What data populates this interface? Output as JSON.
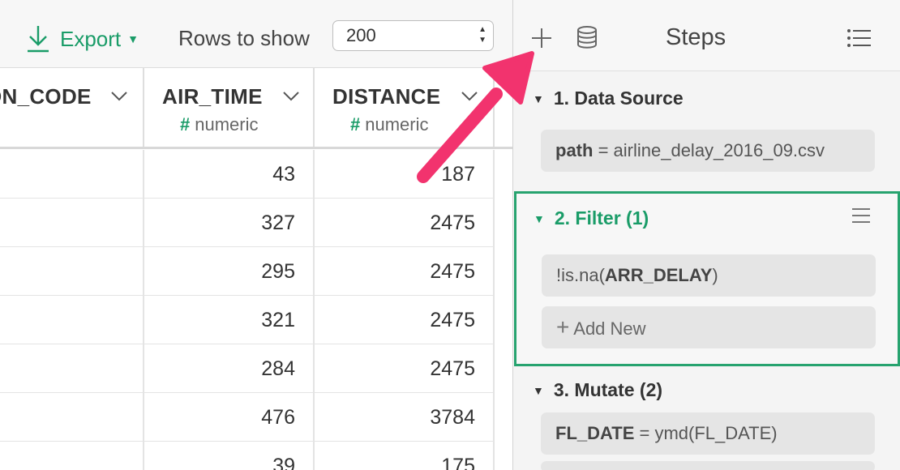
{
  "toolbar": {
    "export_label": "Export",
    "rows_label": "Rows to show",
    "rows_value": "200"
  },
  "table": {
    "columns": [
      {
        "name": "ON_CODE",
        "type": ""
      },
      {
        "name": "AIR_TIME",
        "type": "numeric"
      },
      {
        "name": "DISTANCE",
        "type": "numeric"
      }
    ],
    "type_symbol": "#",
    "rows": [
      [
        "",
        "43",
        "187"
      ],
      [
        "",
        "327",
        "2475"
      ],
      [
        "",
        "295",
        "2475"
      ],
      [
        "",
        "321",
        "2475"
      ],
      [
        "",
        "284",
        "2475"
      ],
      [
        "",
        "476",
        "3784"
      ],
      [
        "",
        "39",
        "175"
      ]
    ]
  },
  "steps": {
    "title": "Steps",
    "add_icon": "plus-icon",
    "db_icon": "database-icon",
    "menu_icon": "list-icon",
    "items": [
      {
        "label": "1. Data Source",
        "pills": [
          {
            "bold": "path",
            "text": " = airline_delay_2016_09.csv"
          }
        ]
      },
      {
        "label": "2. Filter (1)",
        "pills": [
          {
            "pre": "!is.na(",
            "bold": "ARR_DELAY",
            "post": ")"
          }
        ],
        "add_new": "Add New"
      },
      {
        "label": "3. Mutate (2)",
        "pills": [
          {
            "bold": "FL_DATE",
            "text": " = ymd(FL_DATE)"
          }
        ]
      }
    ]
  },
  "colors": {
    "accent": "#1a9c68",
    "highlight_border": "#27a36f",
    "annotation_arrow": "#f2336e"
  }
}
